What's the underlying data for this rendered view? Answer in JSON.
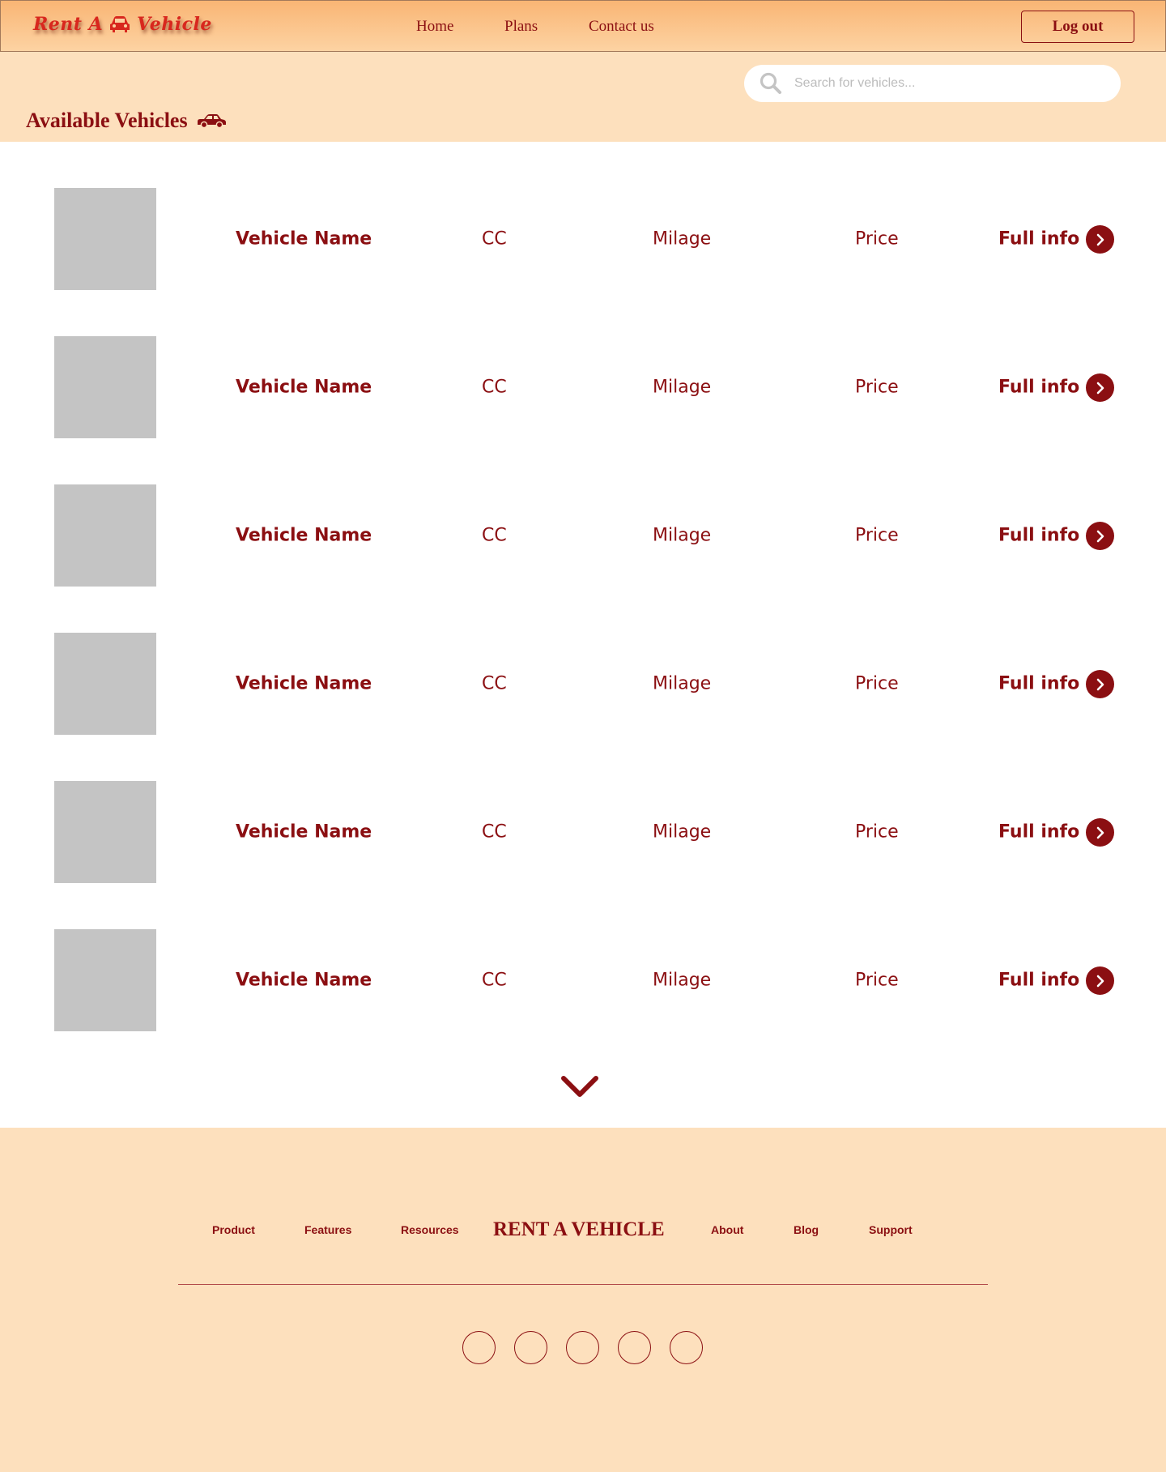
{
  "header": {
    "logo_left": "Rent A",
    "logo_right": "Vehicle",
    "nav": [
      "Home",
      "Plans",
      "Contact us"
    ],
    "logout_label": "Log out"
  },
  "search": {
    "placeholder": "Search for vehicles..."
  },
  "page_title": "Available Vehicles",
  "vehicles": [
    {
      "name": "Vehicle Name",
      "cc": "CC",
      "milage": "Milage",
      "price": "Price",
      "info": "Full info"
    },
    {
      "name": "Vehicle Name",
      "cc": "CC",
      "milage": "Milage",
      "price": "Price",
      "info": "Full info"
    },
    {
      "name": "Vehicle Name",
      "cc": "CC",
      "milage": "Milage",
      "price": "Price",
      "info": "Full info"
    },
    {
      "name": "Vehicle Name",
      "cc": "CC",
      "milage": "Milage",
      "price": "Price",
      "info": "Full info"
    },
    {
      "name": "Vehicle Name",
      "cc": "CC",
      "milage": "Milage",
      "price": "Price",
      "info": "Full info"
    },
    {
      "name": "Vehicle Name",
      "cc": "CC",
      "milage": "Milage",
      "price": "Price",
      "info": "Full info"
    }
  ],
  "footer": {
    "links_left": [
      "Product",
      "Features",
      "Resources"
    ],
    "brand": "RENT A VEHICLE",
    "links_right": [
      "About",
      "Blog",
      "Support"
    ],
    "social_icons": [
      "social-icon",
      "social-icon",
      "social-icon",
      "social-icon",
      "social-icon"
    ]
  },
  "colors": {
    "accent": "#8b0f12",
    "header_gradient_top": "#f9b574",
    "band_bg": "#fde0bd",
    "placeholder_image": "#c4c4c4"
  }
}
